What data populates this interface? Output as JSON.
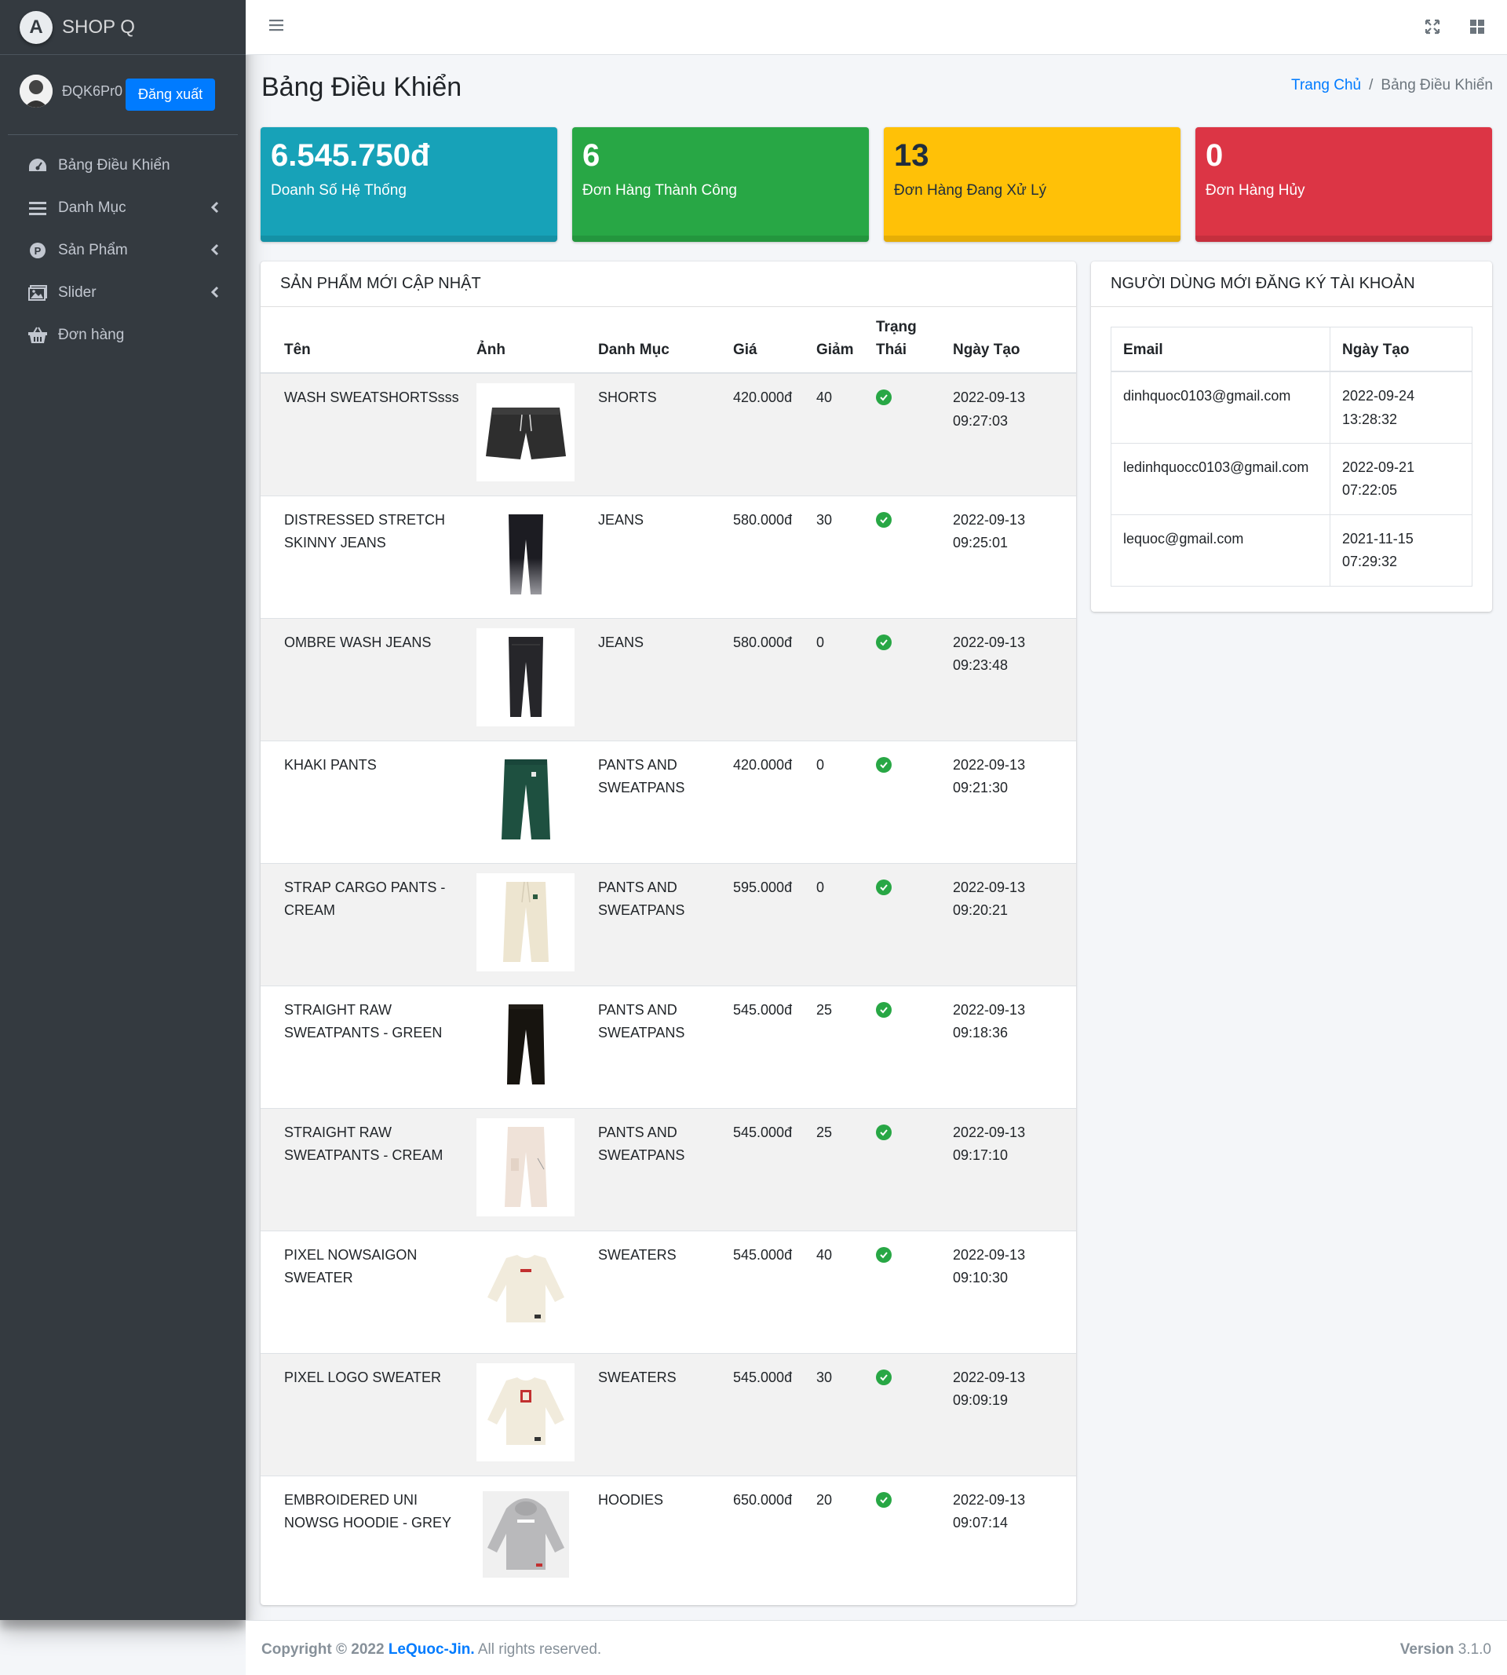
{
  "brand": {
    "logo_letter": "A",
    "name": "SHOP Q"
  },
  "user": {
    "name": "ĐQK6Pr0",
    "logout_label": "Đăng xuất"
  },
  "sidebar": {
    "items": [
      {
        "label": "Bảng Điều Khiển",
        "icon": "dashboard-icon",
        "has_arrow": false
      },
      {
        "label": "Danh Mục",
        "icon": "list-icon",
        "has_arrow": true
      },
      {
        "label": "Sản Phẩm",
        "icon": "product-p-icon",
        "has_arrow": true
      },
      {
        "label": "Slider",
        "icon": "image-icon",
        "has_arrow": true
      },
      {
        "label": "Đơn hàng",
        "icon": "basket-icon",
        "has_arrow": false
      }
    ]
  },
  "header": {
    "title": "Bảng Điều Khiển",
    "breadcrumb": {
      "home": "Trang Chủ",
      "sep": "/",
      "current": "Bảng Điều Khiển"
    }
  },
  "stats": [
    {
      "value": "6.545.750đ",
      "label": "Doanh Số Hệ Thống",
      "color": "#17a2b8"
    },
    {
      "value": "6",
      "label": "Đơn Hàng Thành Công",
      "color": "#28a745"
    },
    {
      "value": "13",
      "label": "Đơn Hàng Đang Xử Lý",
      "color": "#ffc107"
    },
    {
      "value": "0",
      "label": "Đơn Hàng Hủy",
      "color": "#dc3545"
    }
  ],
  "products_card": {
    "title": "SẢN PHẨM MỚI CẬP NHẬT",
    "columns": {
      "name": "Tên",
      "image": "Ảnh",
      "category": "Danh Mục",
      "price": "Giá",
      "discount": "Giảm",
      "status_1": "Trạng",
      "status_2": "Thái",
      "created": "Ngày Tạo"
    },
    "rows": [
      {
        "name": "WASH SWEATSHORTSsss",
        "img": "shorts",
        "category": "SHORTS",
        "price": "420.000đ",
        "discount": "40",
        "date": "2022-09-13",
        "time": "09:27:03"
      },
      {
        "name": "DISTRESSED STRETCH SKINNY JEANS",
        "img": "jeans-fade",
        "category": "JEANS",
        "price": "580.000đ",
        "discount": "30",
        "date": "2022-09-13",
        "time": "09:25:01"
      },
      {
        "name": "OMBRE WASH JEANS",
        "img": "jeans-dark",
        "category": "JEANS",
        "price": "580.000đ",
        "discount": "0",
        "date": "2022-09-13",
        "time": "09:23:48"
      },
      {
        "name": "KHAKI PANTS",
        "img": "pants-green",
        "category": "PANTS AND SWEATPANS",
        "price": "420.000đ",
        "discount": "0",
        "date": "2022-09-13",
        "time": "09:21:30"
      },
      {
        "name": "STRAP CARGO PANTS - CREAM",
        "img": "pants-cream",
        "category": "PANTS AND SWEATPANS",
        "price": "595.000đ",
        "discount": "0",
        "date": "2022-09-13",
        "time": "09:20:21"
      },
      {
        "name": "STRAIGHT RAW SWEATPANTS - GREEN",
        "img": "pants-black",
        "category": "PANTS AND SWEATPANS",
        "price": "545.000đ",
        "discount": "25",
        "date": "2022-09-13",
        "time": "09:18:36"
      },
      {
        "name": "STRAIGHT RAW SWEATPANTS - CREAM",
        "img": "pants-light",
        "category": "PANTS AND SWEATPANS",
        "price": "545.000đ",
        "discount": "25",
        "date": "2022-09-13",
        "time": "09:17:10"
      },
      {
        "name": "PIXEL NOWSAIGON SWEATER",
        "img": "sweater-cream",
        "category": "SWEATERS",
        "price": "545.000đ",
        "discount": "40",
        "date": "2022-09-13",
        "time": "09:10:30"
      },
      {
        "name": "PIXEL LOGO SWEATER",
        "img": "sweater-logo",
        "category": "SWEATERS",
        "price": "545.000đ",
        "discount": "30",
        "date": "2022-09-13",
        "time": "09:09:19"
      },
      {
        "name": "EMBROIDERED UNI NOWSG HOODIE - GREY",
        "img": "hoodie-grey",
        "category": "HOODIES",
        "price": "650.000đ",
        "discount": "20",
        "date": "2022-09-13",
        "time": "09:07:14"
      }
    ]
  },
  "users_card": {
    "title": "NGƯỜI DÙNG MỚI ĐĂNG KÝ TÀI KHOẢN",
    "columns": {
      "email": "Email",
      "created": "Ngày Tạo"
    },
    "rows": [
      {
        "email": "dinhquoc0103@gmail.com",
        "date": "2022-09-24",
        "time": "13:28:32"
      },
      {
        "email": "ledinhquocc0103@gmail.com",
        "date": "2022-09-21",
        "time": "07:22:05"
      },
      {
        "email": "lequoc@gmail.com",
        "date": "2021-11-15",
        "time": "07:29:32"
      }
    ]
  },
  "footer": {
    "copyright": "Copyright © 2022",
    "author": "LeQuoc-Jin.",
    "rights": "All rights reserved.",
    "version_label": "Version",
    "version": "3.1.0"
  }
}
